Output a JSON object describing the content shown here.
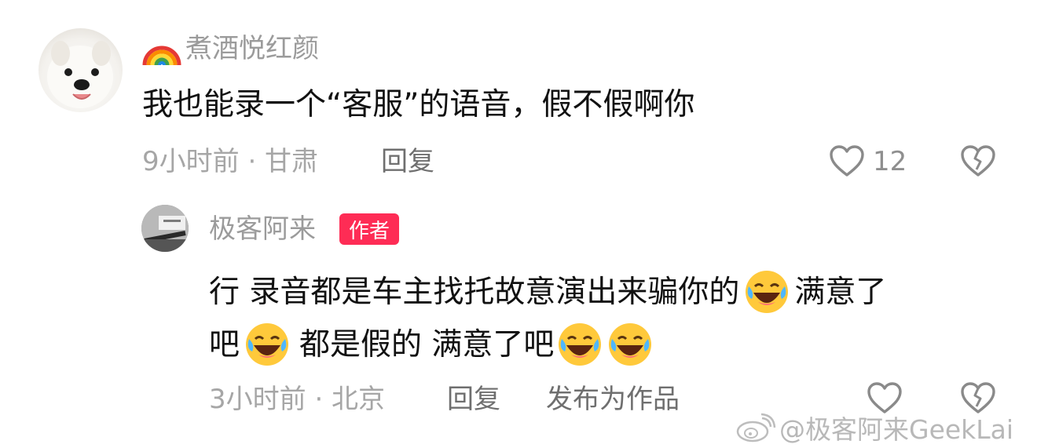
{
  "comment": {
    "username_emoji": "rainbow-icon",
    "username": "煮酒悦红颜",
    "text": "我也能录一个“客服”的语音，假不假啊你",
    "meta": "9小时前 · 甘肃",
    "reply_label": "回复",
    "like_count": "12"
  },
  "reply": {
    "username": "极客阿来",
    "badge": "作者",
    "line1_text": "行 录音都是车主找托故意演出来骗你的",
    "line1_after_emoji": "满意了",
    "line2_start": "吧",
    "line2_middle": "都是假的 满意了吧",
    "meta": "3小时前 · 北京",
    "reply_label": "回复",
    "publish_label": "发布为作品"
  },
  "watermark": {
    "logo": "weibo-icon",
    "text": "@极客阿来GeekLai"
  },
  "colors": {
    "badge": "#fe2c55",
    "username": "#9b9b9b",
    "meta": "#a6a6a6"
  }
}
